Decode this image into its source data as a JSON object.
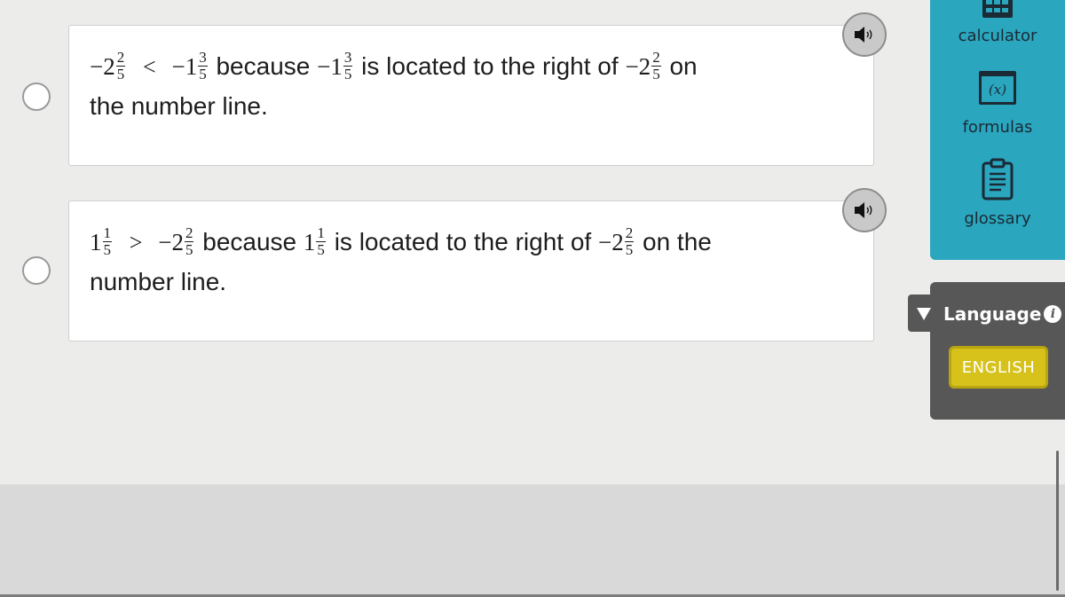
{
  "options": [
    {
      "segments": {
        "a_sign": "−2",
        "a_num": "2",
        "a_den": "5",
        "rel": "<",
        "b_sign": "−1",
        "b_num": "3",
        "b_den": "5",
        "t1": "because",
        "c_sign": "−1",
        "c_num": "3",
        "c_den": "5",
        "t2": "is located to the right of",
        "d_sign": "−2",
        "d_num": "2",
        "d_den": "5",
        "t3": "on",
        "t4": "the number line."
      }
    },
    {
      "segments": {
        "a_sign": "1",
        "a_num": "1",
        "a_den": "5",
        "rel": ">",
        "b_sign": "−2",
        "b_num": "2",
        "b_den": "5",
        "t1": "because",
        "c_sign": "1",
        "c_num": "1",
        "c_den": "5",
        "t2": "is located to the right of",
        "d_sign": "−2",
        "d_num": "2",
        "d_den": "5",
        "t3": "on the",
        "t4": "number line."
      }
    }
  ],
  "tools": {
    "calculator_label": "calculator",
    "formulas_label": "formulas",
    "formulas_icon_text": "(x)",
    "glossary_label": "glossary"
  },
  "language": {
    "toggle_label": "Language",
    "info_glyph": "i",
    "selected": "ENGLISH"
  },
  "colors": {
    "tools_panel": "#2aa6bf",
    "language_panel": "#575757",
    "english_button": "#d6c21b"
  },
  "icons": {
    "speaker": "speaker-icon",
    "calculator": "calculator-icon",
    "formulas": "formulas-icon",
    "glossary": "clipboard-icon",
    "info": "info-icon"
  }
}
